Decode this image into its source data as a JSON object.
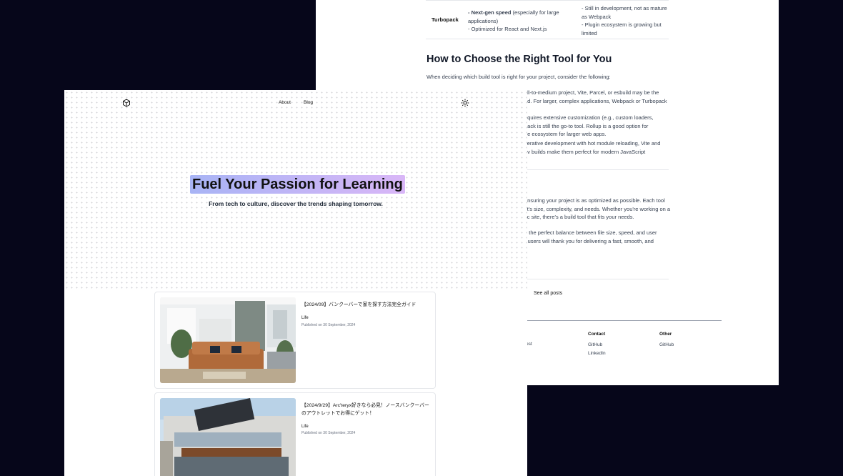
{
  "back": {
    "table_row": {
      "tool": "Turbopack",
      "pros_bold": "Next-gen speed",
      "pros_rest": "(especially for large applications)",
      "pros_2": "- Optimized for React and Next.js",
      "cons_1": "- Still in development, not as mature as Webpack",
      "cons_2": "- Plugin ecosystem is growing but limited"
    },
    "heading": "How to Choose the Right Tool for You",
    "intro": "When deciding which build tool is right for your project, consider the following:",
    "p1_line1": "all-to-medium project, Vite, Parcel, or esbuild may be the",
    "p1_line2": "ed. For larger, complex applications, Webpack or Turbopack",
    "p2_line1": "equires extensive customization (e.g., custom loaders,",
    "p2_line2": "pack is still the go-to tool. Rollup is a good option for",
    "p2_line3": "he ecosystem for larger web apps.",
    "p3_line1": "iterative development with hot module reloading, Vite and",
    "p3_line2": "ev builds make them perfect for modern JavaScript",
    "c1_line1": "ensuring your project is as optimized as possible. Each tool",
    "c1_line2": "ct's size, complexity, and needs. Whether you're working on a",
    "c1_line3": "tic site, there's a build tool that fits your needs.",
    "c2_line1": "g the perfect balance between file size, speed, and user",
    "c2_line2": "r users will thank you for delivering a fast, smooth, and",
    "see_all": "See all posts",
    "footer": {
      "partial": "ost",
      "contact_title": "Contact",
      "contact_links": [
        "GitHub",
        "LinkedIn"
      ],
      "other_title": "Other",
      "other_links": [
        "GitHub"
      ]
    }
  },
  "front": {
    "nav": {
      "about": "About",
      "blog": "Blog"
    },
    "hero": {
      "title": "Fuel Your Passion for Learning",
      "subtitle": "From tech to culture, discover the trends shaping tomorrow."
    },
    "posts": [
      {
        "title": "【2024/09】バンクーバーで家を探す方法完全ガイド",
        "category": "Life",
        "date": "Published on 30 September, 2024"
      },
      {
        "title": "【2024/9/29】Arc'teryx好きなら必見！ノースバンクーバーのアウトレットでお得にゲット！",
        "category": "Life",
        "date": "Published on 30 September, 2024"
      }
    ]
  },
  "colors": {
    "page_bg": "#06061a",
    "highlight_start": "#a8b4f5",
    "highlight_end": "#d9b6f7"
  }
}
